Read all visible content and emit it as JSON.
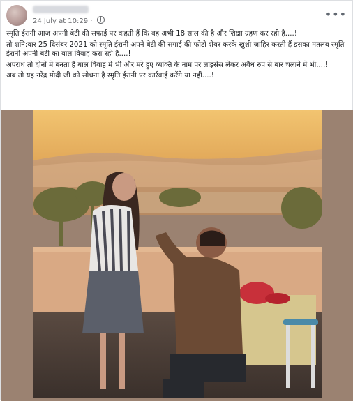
{
  "post": {
    "author_name": "",
    "timestamp": "24 July at 10:29",
    "separator": " · ",
    "more_icon": "more-options-icon",
    "paragraphs": [
      "स्मृति ईरानी आज अपनी बेटी की सफाई पर कहती हैं कि वह अभी 18 साल की है और शिक्षा ग्रहण कर रही है....!",
      "तो शनि:वार 25 दिसंबर 2021 को स्मृति ईरानी अपने बेटी की सगाई की फोटो शेयर करके खुशी जाहिर करती हैं इसका मतलब स्मृति ईरानी अपनी बेटी का बाल विवाह करा रही है....!",
      "अपराध तो दोनों में बनता है बाल विवाह में भी और मरे हुए व्यक्ति के नाम पर लाइसेंस लेकर अवैध रुप से बार चलाने में भी....!",
      "अब तो यह नरेंद्र मोदी जी को सोचना है स्मृति ईरानी पर कार्रवाई करेंगे या नहीं....!"
    ]
  },
  "colors": {
    "sky": "#e9b55f",
    "dunes": "#c99a6b",
    "floor": "#4a3d36"
  }
}
